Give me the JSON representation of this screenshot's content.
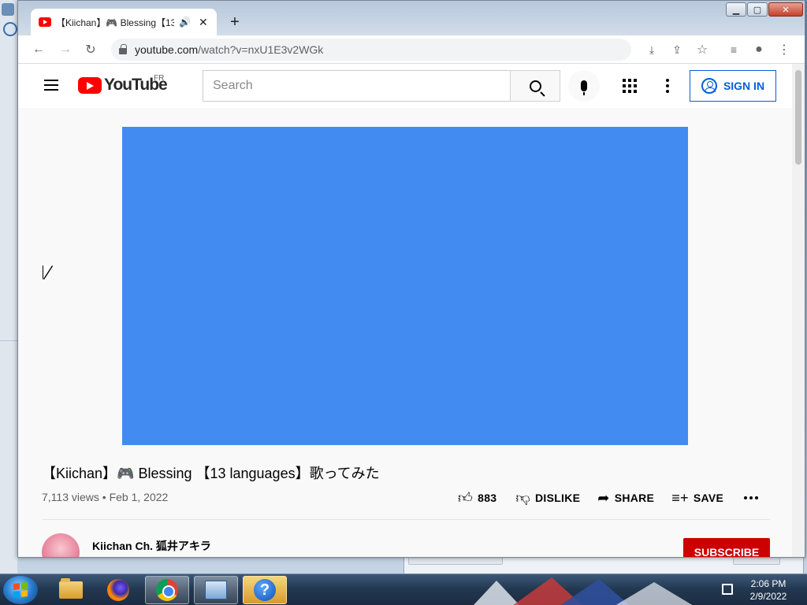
{
  "browser": {
    "tab_title": "【Kiichan】🎮 Blessing【13 languages】歌ってみた",
    "url_host": "youtube.com",
    "url_path": "/watch?v=nxU1E3v2WGk",
    "window_controls": {
      "minimize": "▁",
      "maximize": "▢",
      "close": "✕"
    }
  },
  "youtube": {
    "logo_text": "YouTube",
    "country_code": "FR",
    "search_placeholder": "Search",
    "sign_in_label": "SIGN IN",
    "player_color": "#428BF0"
  },
  "video": {
    "title": "【Kiichan】🎮 Blessing 【13 languages】歌ってみた",
    "views": "7,113 views",
    "date": "Feb 1, 2022",
    "meta_separator": "•",
    "actions": {
      "like_count": "883",
      "dislike_label": "DISLIKE",
      "share_label": "SHARE",
      "save_label": "SAVE"
    }
  },
  "channel": {
    "name": "Kiichan Ch. 狐井アキラ",
    "subscribe_label": "SUBSCRIBE"
  },
  "taskbar": {
    "time": "2:06 PM",
    "date": "2/9/2022",
    "pinned": [
      "file-explorer",
      "firefox",
      "chrome",
      "remote-desktop",
      "help"
    ]
  },
  "colors": {
    "youtube_red": "#FF0000",
    "link_blue": "#065FD4",
    "subscribe_red": "#CC0000"
  }
}
